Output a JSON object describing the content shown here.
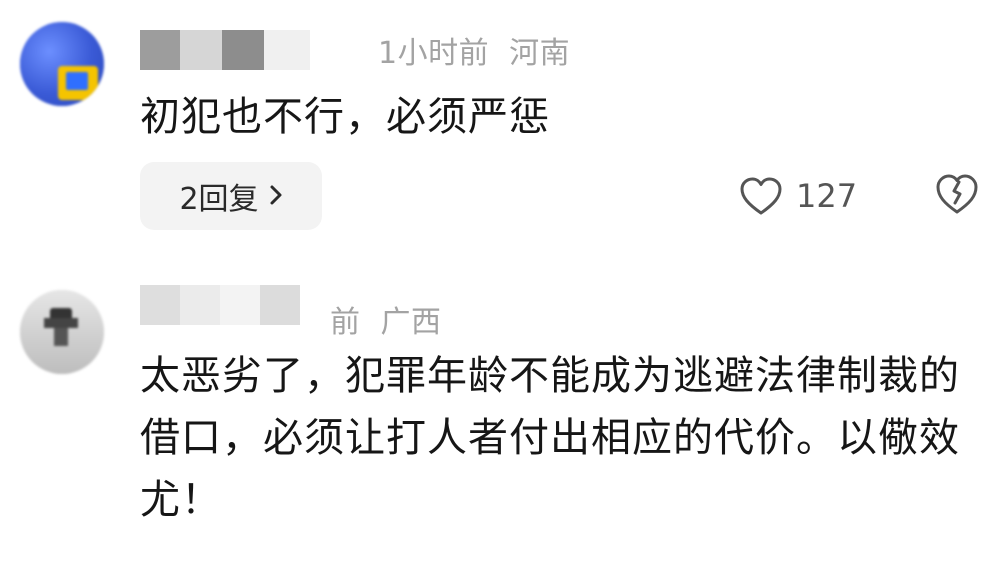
{
  "comments": [
    {
      "time": "1小时前",
      "region": "河南",
      "text": "初犯也不行，必须严惩",
      "reply_label": "2回复",
      "likes": "127",
      "avatar_colors": [
        "#3b5fd9",
        "#f2c400",
        "#2f80ff"
      ]
    },
    {
      "time": "前",
      "region": "广西",
      "text": "太恶劣了，犯罪年龄不能成为逃避法律制裁的借口，必须让打人者付出相应的代价。以儆效尤！"
    }
  ],
  "icons": {
    "like": "heart-outline-icon",
    "dislike": "broken-heart-icon",
    "reply_chevron": "chevron-right-icon"
  }
}
